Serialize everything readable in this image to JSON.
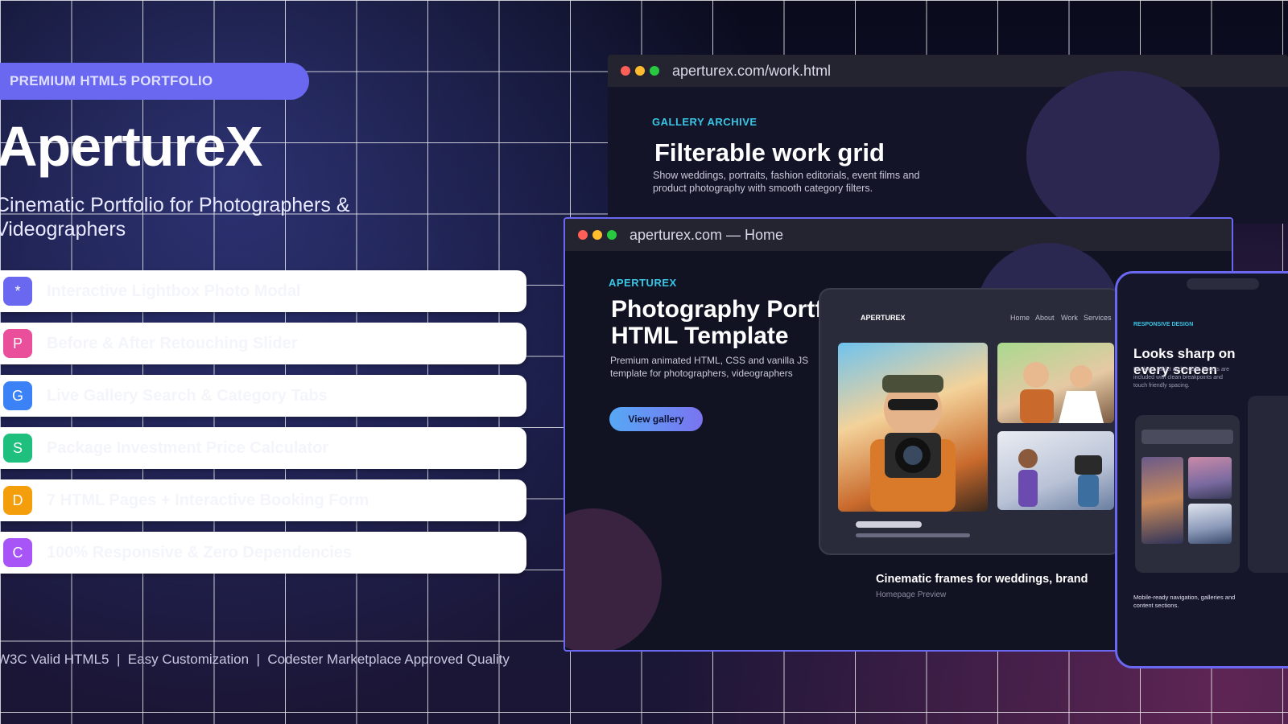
{
  "left": {
    "badge": "PREMIUM HTML5 PORTFOLIO",
    "title": "ApertureX",
    "subtitle": "Cinematic Portfolio for Photographers & Videographers",
    "features": [
      {
        "letter": "*",
        "label": "Interactive Lightbox Photo Modal",
        "color": "#6a67f0"
      },
      {
        "letter": "P",
        "label": "Before & After Retouching Slider",
        "color": "#e94f9a"
      },
      {
        "letter": "G",
        "label": "Live Gallery Search & Category Tabs",
        "color": "#3b82f6"
      },
      {
        "letter": "S",
        "label": "Package Investment Price Calculator",
        "color": "#1fbf7e"
      },
      {
        "letter": "D",
        "label": "7 HTML Pages + Interactive Booking Form",
        "color": "#f59e0b"
      },
      {
        "letter": "C",
        "label": "100% Responsive & Zero Dependencies",
        "color": "#a855f7"
      }
    ],
    "footer": "W3C Valid HTML5  |  Easy Customization  |  Codester Marketplace Approved Quality"
  },
  "work_window": {
    "url": "aperturex.com/work.html",
    "eyebrow": "GALLERY ARCHIVE",
    "heading": "Filterable work grid",
    "text": "Show weddings, portraits, fashion editorials, event films and product photography with smooth category filters."
  },
  "home_window": {
    "url": "aperturex.com — Home",
    "eyebrow": "APERTUREX",
    "heading": "Photography Portfolio HTML Template",
    "text": "Premium animated HTML, CSS and vanilla JS template for photographers, videographers",
    "button": "View gallery",
    "tablet_nav": [
      "Home",
      "About",
      "Work",
      "Services"
    ],
    "tablet_brand": "APERTUREX",
    "caption": "Cinematic frames for weddings, brand",
    "caption_sub": "Homepage Preview"
  },
  "phone": {
    "eyebrow": "RESPONSIVE DESIGN",
    "heading": "Looks sharp on every screen",
    "text": "Desktop, tablet and mobile layouts are included with clean breakpoints and touch friendly spacing.",
    "footer": "Mobile-ready navigation, galleries and content sections."
  },
  "colors": {
    "accent": "#6a67f0",
    "cyan": "#39c6e6",
    "dot_red": "#ff5f57",
    "dot_yellow": "#febc2e",
    "dot_green": "#28c840"
  }
}
